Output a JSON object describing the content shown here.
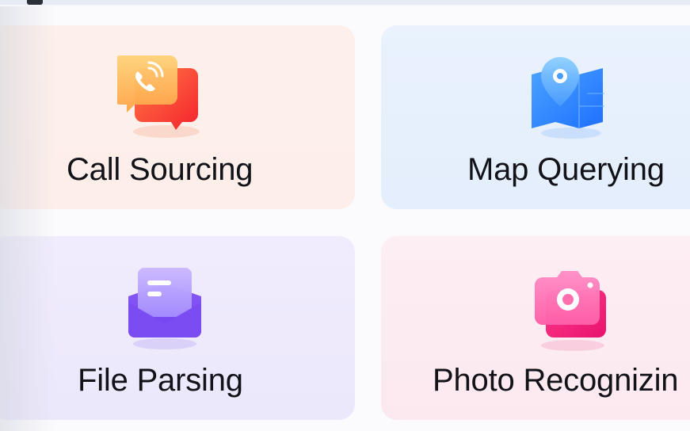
{
  "cards": [
    {
      "label": "Call Sourcing",
      "icon": "phone-chat-icon"
    },
    {
      "label": "Map Querying",
      "icon": "map-pin-icon"
    },
    {
      "label": "File Parsing",
      "icon": "envelope-document-icon"
    },
    {
      "label": "Photo Recognizin",
      "icon": "camera-icon"
    }
  ],
  "colors": {
    "call_card_bg": "#fdf0ea",
    "map_card_bg": "#e9f2fd",
    "file_card_bg": "#f0ecfd",
    "photo_card_bg": "#fdeef3"
  }
}
